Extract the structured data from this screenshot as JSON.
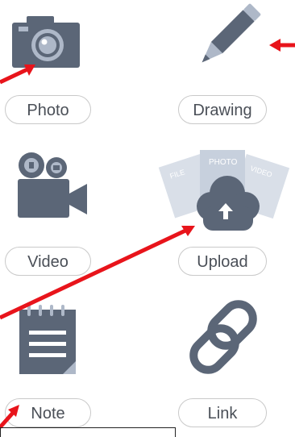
{
  "tiles": {
    "photo": {
      "label": "Photo",
      "icon": "camera-icon"
    },
    "drawing": {
      "label": "Drawing",
      "icon": "pencil-icon"
    },
    "video": {
      "label": "Video",
      "icon": "video-camera-icon"
    },
    "upload": {
      "label": "Upload",
      "icon": "cloud-upload-icon",
      "cards": [
        "FILE",
        "PHOTO",
        "VIDEO"
      ]
    },
    "note": {
      "label": "Note",
      "icon": "notepad-icon"
    },
    "link": {
      "label": "Link",
      "icon": "chain-link-icon"
    }
  },
  "colors": {
    "icon": "#5b6677",
    "icon_light": "#aeb8c8",
    "pill_border": "#c9c9c9",
    "pill_text": "#4a4f57",
    "annotation_arrow": "#e8141b"
  }
}
